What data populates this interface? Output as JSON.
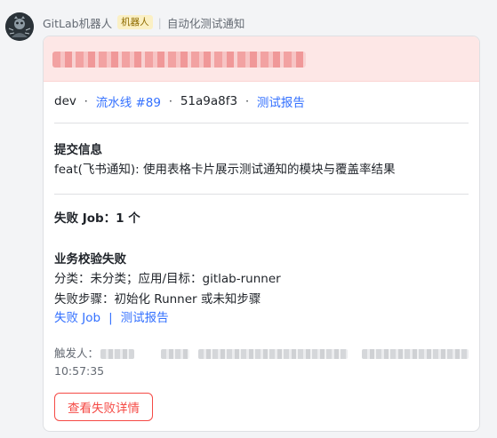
{
  "sender": {
    "name": "GitLab机器人",
    "badge": "机器人",
    "subtitle": "自动化测试通知"
  },
  "meta": {
    "branch": "dev",
    "pipeline_label": "流水线 #89",
    "commit": "51a9a8f3",
    "report_link": "测试报告"
  },
  "commit_info": {
    "title": "提交信息",
    "message": "feat(飞书通知): 使用表格卡片展示测试通知的模块与覆盖率结果"
  },
  "failed_jobs": {
    "title": "失败 Job：1 个"
  },
  "business_check": {
    "title": "业务校验失败",
    "category_line": "分类：未分类；应用/目标：gitlab-runner",
    "step_line": "失败步骤：初始化 Runner 或未知步骤",
    "job_link": "失败 Job",
    "separator": "|",
    "report_link": "测试报告"
  },
  "trigger": {
    "label": "触发人：",
    "time": "10:57:35"
  },
  "action": {
    "button_label": "查看失败详情"
  },
  "colors": {
    "link": "#3370ff",
    "danger": "#f54a45",
    "header_bg": "#fde7e6"
  }
}
